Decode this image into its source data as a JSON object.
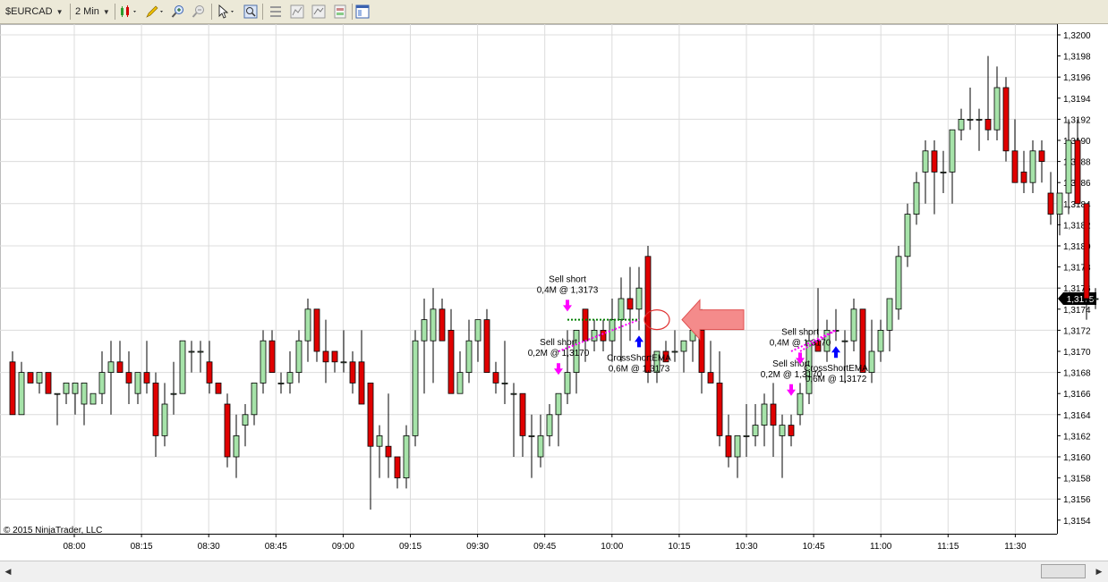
{
  "toolbar": {
    "instrument": "$EURCAD",
    "interval": "2 Min",
    "icons": [
      "candlestick-style-icon",
      "drawing-pencil-icon",
      "zoom-in-icon",
      "zoom-out-icon",
      "cursor-pointer-icon",
      "data-box-icon",
      "properties-icon",
      "indicators-icon",
      "strategies-icon",
      "chart-trader-icon",
      "window-icon"
    ]
  },
  "copyright": "© 2015 NinjaTrader, LLC",
  "current_price": "1,3175",
  "colors": {
    "up": "#a6e3a9",
    "down": "#e00000",
    "grid": "#dcdcdc",
    "sell_arrow": "#ff00ff",
    "buy_arrow": "#0000ff",
    "price_flag": "#000000"
  },
  "chart_data": {
    "type": "candlestick",
    "instrument": "$EURCAD",
    "interval": "2 Min",
    "x_tick_labels": [
      "08:00",
      "08:15",
      "08:30",
      "08:45",
      "09:00",
      "09:15",
      "09:30",
      "09:45",
      "10:00",
      "10:15",
      "10:30",
      "10:45",
      "11:00",
      "11:15",
      "11:30"
    ],
    "y_tick_labels": [
      "1,3200",
      "1,3198",
      "1,3196",
      "1,3194",
      "1,3192",
      "1,3190",
      "1,3188",
      "1,3186",
      "1,3184",
      "1,3182",
      "1,3180",
      "1,3178",
      "1,3176",
      "1,3174",
      "1,3172",
      "1,3170",
      "1,3168",
      "1,3166",
      "1,3164",
      "1,3162",
      "1,3160",
      "1,3158",
      "1,3156",
      "1,3154"
    ],
    "ylim": [
      1.31535,
      1.32005
    ],
    "grid": true,
    "ohlc": [
      [
        1.3169,
        1.317,
        1.3164,
        1.3164
      ],
      [
        1.3164,
        1.3169,
        1.3164,
        1.3168
      ],
      [
        1.3168,
        1.3168,
        1.3167,
        1.3167
      ],
      [
        1.3167,
        1.3168,
        1.3166,
        1.3168
      ],
      [
        1.3168,
        1.3168,
        1.3166,
        1.3166
      ],
      [
        1.3166,
        1.3166,
        1.3163,
        1.3166
      ],
      [
        1.3166,
        1.3167,
        1.3165,
        1.3167
      ],
      [
        1.3166,
        1.3167,
        1.3164,
        1.3167
      ],
      [
        1.3165,
        1.3167,
        1.3163,
        1.3167
      ],
      [
        1.3165,
        1.3166,
        1.3165,
        1.3166
      ],
      [
        1.3166,
        1.317,
        1.3165,
        1.3168
      ],
      [
        1.3168,
        1.3171,
        1.3164,
        1.3169
      ],
      [
        1.3169,
        1.3171,
        1.3168,
        1.3168
      ],
      [
        1.3168,
        1.317,
        1.3165,
        1.3167
      ],
      [
        1.3166,
        1.3167,
        1.3165,
        1.3168
      ],
      [
        1.3168,
        1.3171,
        1.3166,
        1.3167
      ],
      [
        1.3167,
        1.3168,
        1.316,
        1.3162
      ],
      [
        1.3162,
        1.3167,
        1.3161,
        1.3165
      ],
      [
        1.3166,
        1.3169,
        1.3164,
        1.3166
      ],
      [
        1.3166,
        1.3171,
        1.3166,
        1.3171
      ],
      [
        1.317,
        1.3171,
        1.3168,
        1.317
      ],
      [
        1.317,
        1.3171,
        1.3168,
        1.317
      ],
      [
        1.3169,
        1.3171,
        1.3166,
        1.3167
      ],
      [
        1.3167,
        1.3167,
        1.3166,
        1.3166
      ],
      [
        1.3165,
        1.3166,
        1.3159,
        1.316
      ],
      [
        1.316,
        1.3164,
        1.3158,
        1.3162
      ],
      [
        1.3163,
        1.3165,
        1.3161,
        1.3164
      ],
      [
        1.3164,
        1.3166,
        1.3163,
        1.3167
      ],
      [
        1.3167,
        1.3172,
        1.3166,
        1.3171
      ],
      [
        1.3171,
        1.3172,
        1.3168,
        1.3168
      ],
      [
        1.3167,
        1.3168,
        1.3166,
        1.3167
      ],
      [
        1.3167,
        1.317,
        1.3166,
        1.3168
      ],
      [
        1.3168,
        1.3172,
        1.3167,
        1.3171
      ],
      [
        1.3171,
        1.3175,
        1.3169,
        1.3174
      ],
      [
        1.3174,
        1.3174,
        1.3169,
        1.317
      ],
      [
        1.317,
        1.3173,
        1.3167,
        1.3169
      ],
      [
        1.317,
        1.317,
        1.3168,
        1.3169
      ],
      [
        1.3169,
        1.3172,
        1.3168,
        1.3169
      ],
      [
        1.3169,
        1.317,
        1.3166,
        1.3167
      ],
      [
        1.3169,
        1.3172,
        1.3166,
        1.3165
      ],
      [
        1.3167,
        1.3167,
        1.3155,
        1.3161
      ],
      [
        1.3161,
        1.3163,
        1.3158,
        1.3162
      ],
      [
        1.3161,
        1.3166,
        1.3158,
        1.316
      ],
      [
        1.316,
        1.316,
        1.3157,
        1.3158
      ],
      [
        1.3158,
        1.3163,
        1.3157,
        1.3162
      ],
      [
        1.3162,
        1.3172,
        1.3161,
        1.3171
      ],
      [
        1.3171,
        1.3175,
        1.3166,
        1.3173
      ],
      [
        1.3171,
        1.3176,
        1.3167,
        1.3174
      ],
      [
        1.3174,
        1.3175,
        1.3171,
        1.3171
      ],
      [
        1.3172,
        1.3174,
        1.3166,
        1.3166
      ],
      [
        1.3166,
        1.317,
        1.3166,
        1.3168
      ],
      [
        1.3168,
        1.3173,
        1.3167,
        1.3171
      ],
      [
        1.3171,
        1.3173,
        1.3169,
        1.3173
      ],
      [
        1.3173,
        1.3174,
        1.3168,
        1.3168
      ],
      [
        1.3168,
        1.3169,
        1.3166,
        1.3167
      ],
      [
        1.3167,
        1.3171,
        1.3165,
        1.3167
      ],
      [
        1.3166,
        1.3167,
        1.316,
        1.3166
      ],
      [
        1.3166,
        1.3166,
        1.316,
        1.3162
      ],
      [
        1.3162,
        1.3164,
        1.3158,
        1.3162
      ],
      [
        1.316,
        1.3164,
        1.3159,
        1.3162
      ],
      [
        1.3162,
        1.3165,
        1.3161,
        1.3164
      ],
      [
        1.3164,
        1.3166,
        1.3161,
        1.3166
      ],
      [
        1.3166,
        1.3172,
        1.3165,
        1.3168
      ],
      [
        1.3168,
        1.3172,
        1.3166,
        1.3172
      ],
      [
        1.3174,
        1.3174,
        1.3169,
        1.3171
      ],
      [
        1.3171,
        1.3173,
        1.317,
        1.3172
      ],
      [
        1.3172,
        1.3173,
        1.317,
        1.3171
      ],
      [
        1.3171,
        1.3175,
        1.3169,
        1.3173
      ],
      [
        1.3173,
        1.3177,
        1.3169,
        1.3175
      ],
      [
        1.3175,
        1.3178,
        1.3171,
        1.3174
      ],
      [
        1.3174,
        1.3178,
        1.3172,
        1.3176
      ],
      [
        1.3179,
        1.318,
        1.3167,
        1.3168
      ],
      [
        1.3168,
        1.3169,
        1.3167,
        1.317
      ],
      [
        1.317,
        1.3171,
        1.3169,
        1.3169
      ],
      [
        1.317,
        1.3172,
        1.3169,
        1.317
      ],
      [
        1.317,
        1.3171,
        1.3168,
        1.3171
      ],
      [
        1.3171,
        1.3173,
        1.3169,
        1.3172
      ],
      [
        1.3172,
        1.3174,
        1.3166,
        1.3168
      ],
      [
        1.3168,
        1.3171,
        1.3167,
        1.3167
      ],
      [
        1.3167,
        1.317,
        1.3161,
        1.3162
      ],
      [
        1.3162,
        1.3164,
        1.3159,
        1.316
      ],
      [
        1.316,
        1.3162,
        1.3158,
        1.3162
      ],
      [
        1.3162,
        1.3165,
        1.316,
        1.3162
      ],
      [
        1.3162,
        1.3165,
        1.3161,
        1.3163
      ],
      [
        1.3163,
        1.3166,
        1.3161,
        1.3165
      ],
      [
        1.3165,
        1.3167,
        1.316,
        1.3163
      ],
      [
        1.3162,
        1.3164,
        1.3158,
        1.3163
      ],
      [
        1.3163,
        1.3164,
        1.3161,
        1.3162
      ],
      [
        1.3164,
        1.3167,
        1.3163,
        1.3166
      ],
      [
        1.3166,
        1.3172,
        1.3165,
        1.3171
      ],
      [
        1.3171,
        1.3176,
        1.317,
        1.317
      ],
      [
        1.317,
        1.3173,
        1.3169,
        1.3172
      ],
      [
        1.3172,
        1.3174,
        1.3171,
        1.3172
      ],
      [
        1.3171,
        1.3172,
        1.3167,
        1.3171
      ],
      [
        1.3171,
        1.3175,
        1.317,
        1.3174
      ],
      [
        1.3174,
        1.3174,
        1.3168,
        1.3168
      ],
      [
        1.3168,
        1.3173,
        1.3167,
        1.317
      ],
      [
        1.317,
        1.3173,
        1.3169,
        1.3172
      ],
      [
        1.3172,
        1.3174,
        1.317,
        1.3175
      ],
      [
        1.3174,
        1.318,
        1.3173,
        1.3179
      ],
      [
        1.3179,
        1.3184,
        1.3178,
        1.3183
      ],
      [
        1.3183,
        1.3187,
        1.3182,
        1.3186
      ],
      [
        1.3187,
        1.319,
        1.3184,
        1.3189
      ],
      [
        1.3189,
        1.319,
        1.3183,
        1.3187
      ],
      [
        1.3187,
        1.3189,
        1.3185,
        1.3187
      ],
      [
        1.3187,
        1.319,
        1.3184,
        1.3191
      ],
      [
        1.3191,
        1.3193,
        1.319,
        1.3192
      ],
      [
        1.3192,
        1.3195,
        1.3191,
        1.3192
      ],
      [
        1.3192,
        1.3193,
        1.3189,
        1.3192
      ],
      [
        1.3192,
        1.3198,
        1.319,
        1.3191
      ],
      [
        1.3191,
        1.3197,
        1.319,
        1.3195
      ],
      [
        1.3195,
        1.3196,
        1.3188,
        1.3189
      ],
      [
        1.3189,
        1.3192,
        1.3186,
        1.3186
      ],
      [
        1.3187,
        1.3189,
        1.3185,
        1.3186
      ],
      [
        1.3186,
        1.319,
        1.3185,
        1.3189
      ],
      [
        1.3189,
        1.319,
        1.3186,
        1.3188
      ],
      [
        1.3185,
        1.3187,
        1.3182,
        1.3183
      ],
      [
        1.3183,
        1.3185,
        1.3181,
        1.3185
      ],
      [
        1.3185,
        1.3192,
        1.3183,
        1.319
      ],
      [
        1.319,
        1.3192,
        1.3184,
        1.3184
      ],
      [
        1.3184,
        1.3184,
        1.3173,
        1.3175
      ],
      [
        1.3175,
        1.3176,
        1.3174,
        1.3175
      ]
    ],
    "markers": [
      {
        "type": "sell-short",
        "label": "Sell short",
        "detail": "0,2M @ 1,3170",
        "bar": 61
      },
      {
        "type": "sell-short",
        "label": "Sell short",
        "detail": "0,4M @ 1,3173",
        "bar": 62
      },
      {
        "type": "cross-short-ema",
        "label": "CrossShortEMA",
        "detail": "0,6M @ 1,3173",
        "bar": 70
      },
      {
        "type": "sell-short",
        "label": "Sell short",
        "detail": "0,2M @ 1,3170",
        "bar": 87
      },
      {
        "type": "sell-short",
        "label": "Sell short",
        "detail": "0,4M @ 1,3170",
        "bar": 88
      },
      {
        "type": "cross-short-ema",
        "label": "CrossShortEMA",
        "detail": "0,6M @ 1,3172",
        "bar": 92
      }
    ],
    "annotation": {
      "type": "callout-arrow-and-ellipse",
      "bar": 71,
      "price": 1.3173
    }
  }
}
